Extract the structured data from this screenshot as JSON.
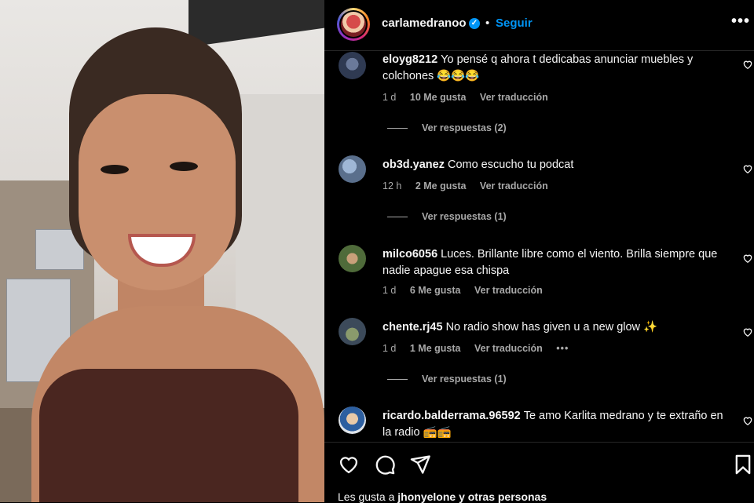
{
  "header": {
    "username": "carlamedranoo",
    "separator": "•",
    "follow_label": "Seguir",
    "more_label": "•••"
  },
  "comments": [
    {
      "user": "eloyg8212",
      "text": "Yo pensé q ahora t dedicabas anunciar muebles y colchones 😂😂😂",
      "time": "1 d",
      "likes": "10 Me gusta",
      "translate": "Ver traducción",
      "replies": "Ver respuestas (2)"
    },
    {
      "user": "ob3d.yanez",
      "text": "Como escucho tu podcat",
      "time": "12 h",
      "likes": "2 Me gusta",
      "translate": "Ver traducción",
      "replies": "Ver respuestas (1)"
    },
    {
      "user": "milco6056",
      "text": "Luces. Brillante libre como el viento. Brilla siempre que nadie apague esa chispa",
      "time": "1 d",
      "likes": "6 Me gusta",
      "translate": "Ver traducción"
    },
    {
      "user": "chente.rj45",
      "text": "No radio show has given u a new glow ✨",
      "time": "1 d",
      "likes": "1 Me gusta",
      "translate": "Ver traducción",
      "dots": "•••",
      "replies": "Ver respuestas (1)"
    },
    {
      "user": "ricardo.balderrama.96592",
      "text": "Te amo Karlita medrano y te extraño en la radio 📻📻"
    }
  ],
  "footer": {
    "liked_by_prefix": "Les gusta a ",
    "liked_by_user": "jhonyelone",
    "liked_by_suffix": " y otras personas"
  },
  "colors": {
    "accent": "#0095f6",
    "background": "#000000",
    "secondary_text": "#a8a8a8"
  }
}
